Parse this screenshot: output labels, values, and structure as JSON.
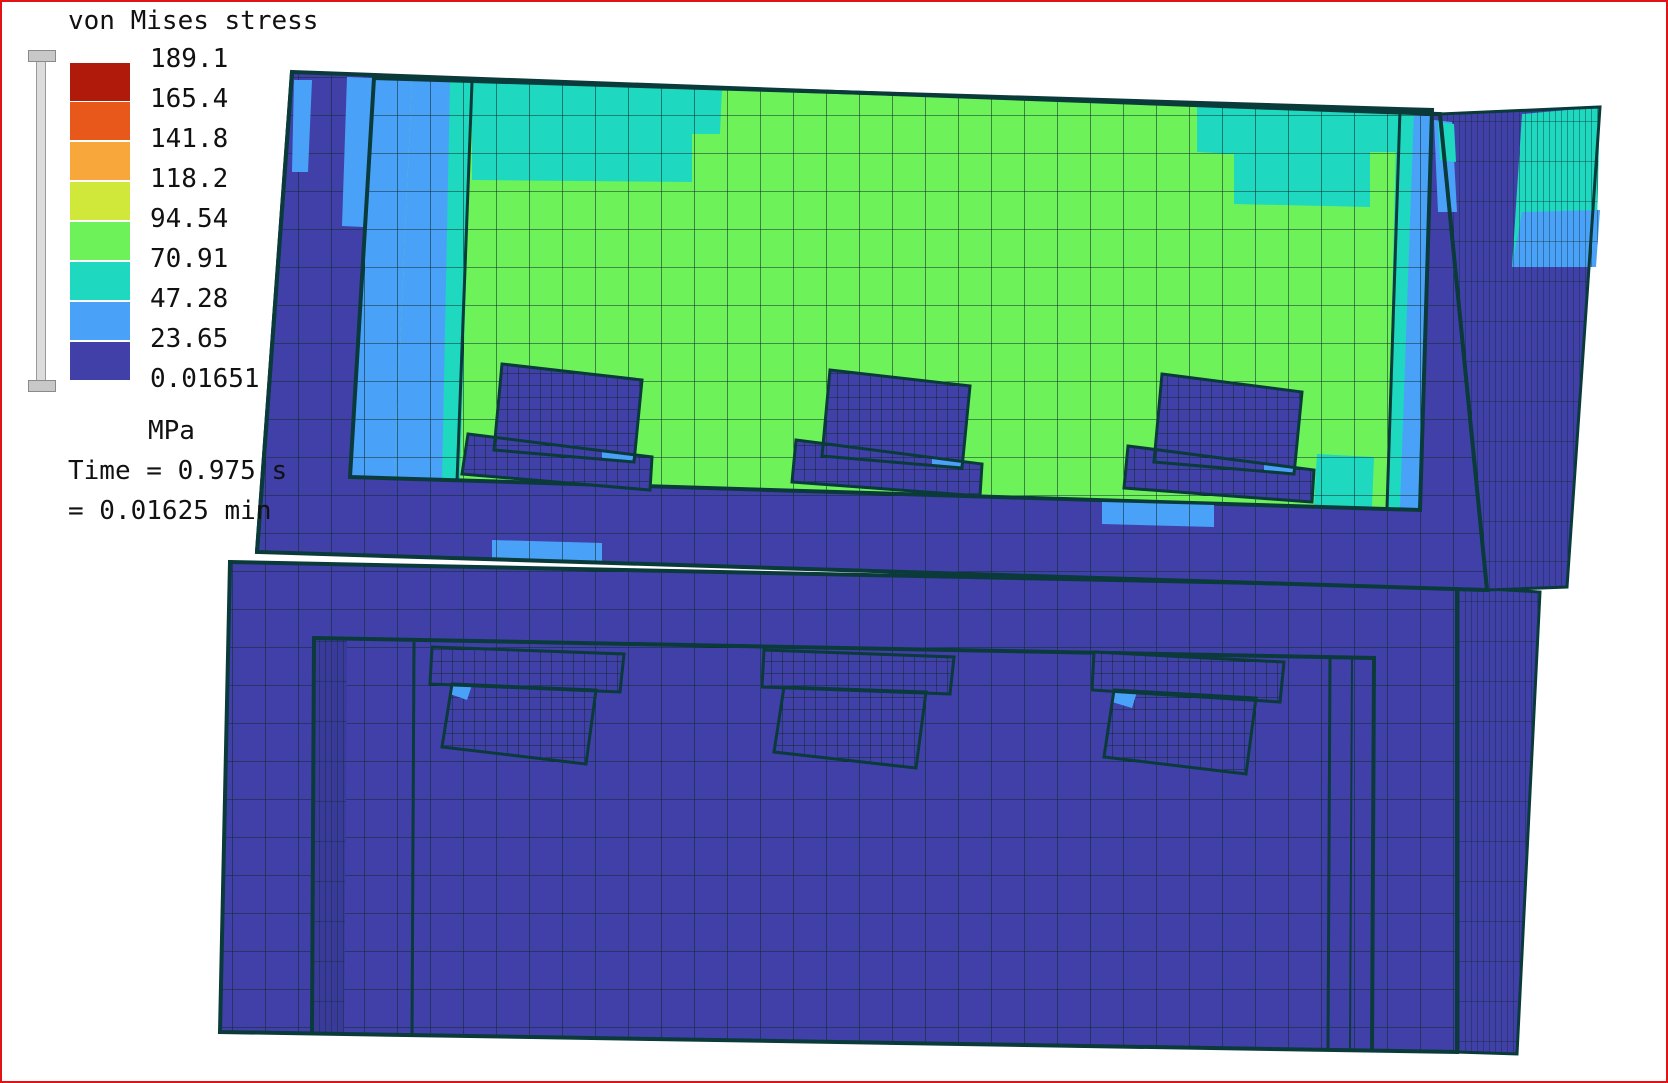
{
  "legend": {
    "title": "von Mises stress",
    "levels": [
      {
        "label": "189.1",
        "color": "#b01a0a"
      },
      {
        "label": "165.4",
        "color": "#e8581a"
      },
      {
        "label": "141.8",
        "color": "#f8a83a"
      },
      {
        "label": "118.2",
        "color": "#d0e83a"
      },
      {
        "label": "94.54",
        "color": "#6ef25a"
      },
      {
        "label": "70.91",
        "color": "#1ed8c0"
      },
      {
        "label": "47.28",
        "color": "#4aa2f8"
      },
      {
        "label": "23.65",
        "color": "#4040a8"
      },
      {
        "label": "0.01651",
        "color": ""
      }
    ],
    "unit": "MPa",
    "time_line1": "Time = 0.975 s",
    "time_line2": "= 0.01625 min"
  },
  "colors": {
    "frame_border": "#e01414",
    "mesh_line": "#0e2a2a",
    "outline": "#0a3a3a",
    "low": "#4040a8",
    "low_mid": "#4aa2f8",
    "mid": "#1ed8c0",
    "mid_high": "#6ef25a"
  }
}
